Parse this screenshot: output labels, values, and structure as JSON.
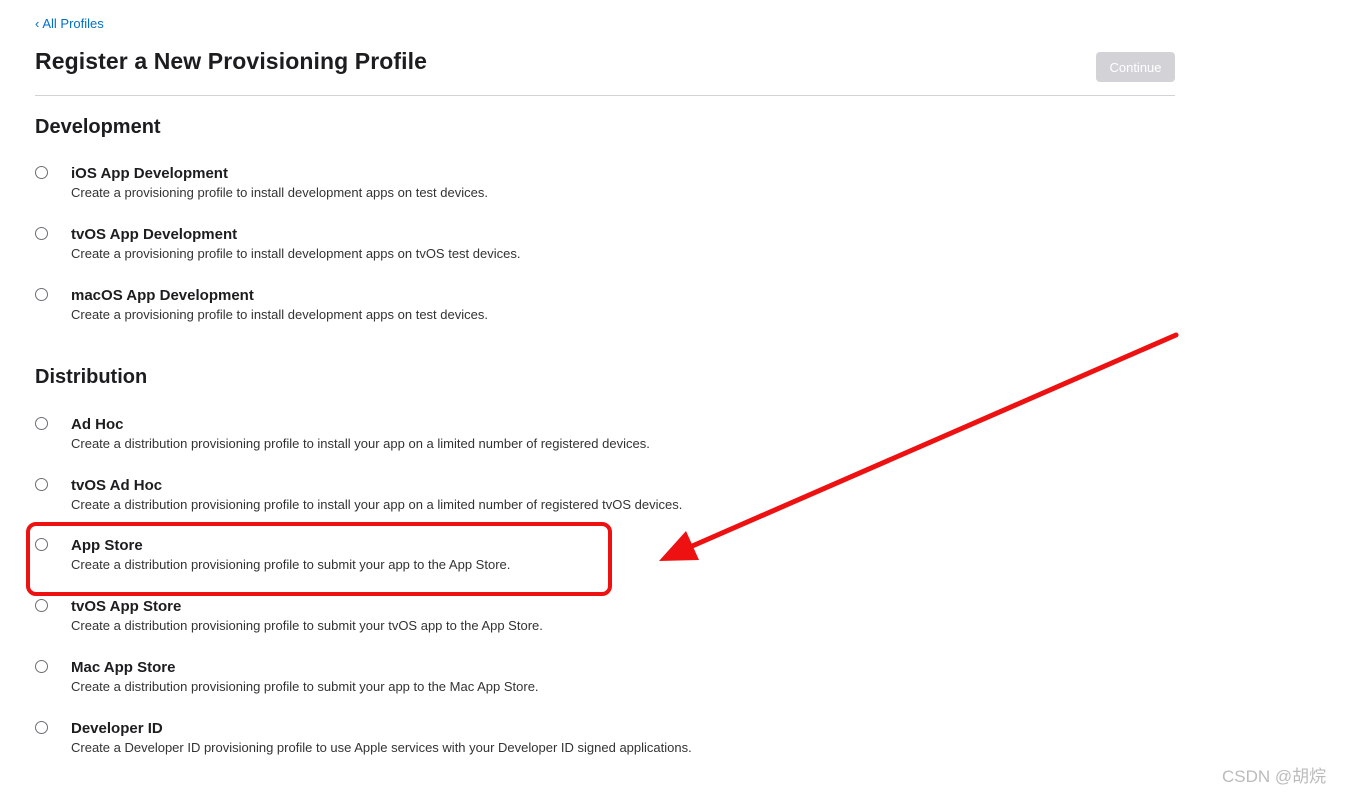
{
  "nav": {
    "back_label": "All Profiles",
    "back_icon": "chevron-left-icon"
  },
  "header": {
    "title": "Register a New Provisioning Profile",
    "continue_label": "Continue"
  },
  "sections": {
    "development": {
      "heading": "Development",
      "options": [
        {
          "title": "iOS App Development",
          "desc": "Create a provisioning profile to install development apps on test devices."
        },
        {
          "title": "tvOS App Development",
          "desc": "Create a provisioning profile to install development apps on tvOS test devices."
        },
        {
          "title": "macOS App Development",
          "desc": "Create a provisioning profile to install development apps on test devices."
        }
      ]
    },
    "distribution": {
      "heading": "Distribution",
      "options": [
        {
          "title": "Ad Hoc",
          "desc": "Create a distribution provisioning profile to install your app on a limited number of registered devices."
        },
        {
          "title": "tvOS Ad Hoc",
          "desc": "Create a distribution provisioning profile to install your app on a limited number of registered tvOS devices."
        },
        {
          "title": "App Store",
          "desc": "Create a distribution provisioning profile to submit your app to the App Store."
        },
        {
          "title": "tvOS App Store",
          "desc": "Create a distribution provisioning profile to submit your tvOS app to the App Store."
        },
        {
          "title": "Mac App Store",
          "desc": "Create a distribution provisioning profile to submit your app to the Mac App Store."
        },
        {
          "title": "Developer ID",
          "desc": "Create a Developer ID provisioning profile to use Apple services with your Developer ID signed applications."
        }
      ]
    }
  },
  "annotation": {
    "color": "#ee1111",
    "highlighted_option": "App Store"
  },
  "colors": {
    "link": "#0070c9",
    "button_disabled_bg": "#d2d2d7",
    "text": "#1d1d1f"
  },
  "watermark": "CSDN @胡烷"
}
